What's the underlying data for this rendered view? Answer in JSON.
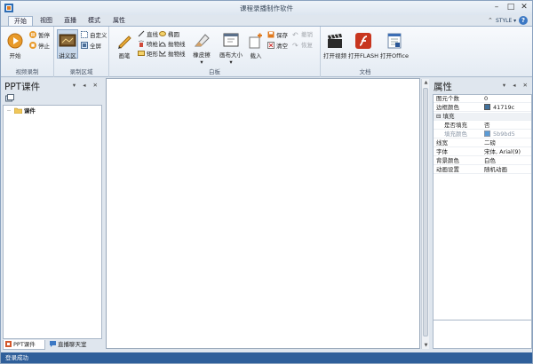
{
  "window": {
    "title": "课程录播制作软件",
    "controls": {
      "minimize": "–",
      "maximize": "□",
      "close": "✕"
    }
  },
  "ribbon_tabs": [
    "开始",
    "视图",
    "直播",
    "模式",
    "属性"
  ],
  "active_tab": "开始",
  "style_menu": "STYLE ▾",
  "help": "?",
  "groups": {
    "video_record": {
      "label": "视频录制",
      "start": "开始",
      "pause": "暂停",
      "stop": "停止"
    },
    "record_area": {
      "label": "录制区域",
      "lecture_area": "讲义区",
      "custom": "自定义",
      "fullscreen": "全屏"
    },
    "whiteboard": {
      "label": "白板",
      "pen": "画笔",
      "line": "直线",
      "ellipse": "椭圆",
      "spray": "喷枪",
      "parabola1": "抛物线",
      "rect": "矩形",
      "parabola2": "抛物线",
      "eraser": "橡皮擦",
      "canvas_size": "画布大小",
      "load": "载入",
      "save": "保存",
      "clear": "清空",
      "undo": "撤销",
      "redo": "恢复"
    },
    "document": {
      "label": "文档",
      "open_video": "打开视频",
      "open_flash": "打开FLASH",
      "open_office": "打开Office"
    }
  },
  "left_panel": {
    "title": "PPT课件",
    "tools": "▾ ◂ ✕",
    "tree": [
      {
        "label": "课件"
      }
    ],
    "bottom_tabs": [
      "PPT课件",
      "直播聊天室"
    ]
  },
  "property_panel": {
    "title": "属性",
    "tools": "▾ ◂ ✕",
    "rows": [
      {
        "key": "图元个数",
        "value": "0"
      },
      {
        "key": "边框颜色",
        "value": "41719c",
        "color": "#41719c"
      },
      {
        "key": "填充",
        "value": "",
        "category": true
      },
      {
        "key": "是否填充",
        "value": "否"
      },
      {
        "key": "填充颜色",
        "value": "5b9bd5",
        "color": "#5b9bd5",
        "dim": true
      },
      {
        "key": "线宽",
        "value": "二磅"
      },
      {
        "key": "字体",
        "value": "宋体, Arial(9)"
      },
      {
        "key": "背景颜色",
        "value": "白色"
      },
      {
        "key": "动画设置",
        "value": "随机动画"
      }
    ]
  },
  "status": {
    "text": "登录成功"
  }
}
